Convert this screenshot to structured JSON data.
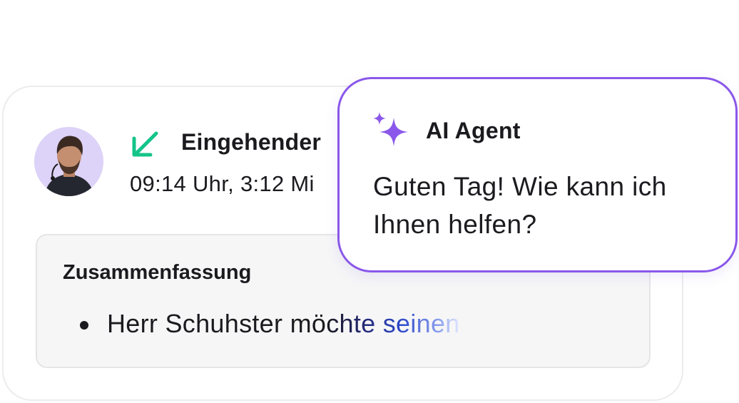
{
  "call": {
    "title": "Eingehender",
    "meta": "09:14 Uhr, 3:12 Mi",
    "direction_icon": "arrow-down-left-icon",
    "direction_color": "#14c48a"
  },
  "summary": {
    "title": "Zusammenfassung",
    "bullet_plain": "Herr Schuhster mö",
    "bullet_faded": "chte seinen"
  },
  "ai_agent": {
    "title": "AI Agent",
    "message": "Guten Tag! Wie kann ich Ihnen helfen?",
    "icon": "sparkle-icon",
    "accent_color": "#8a57ea"
  }
}
